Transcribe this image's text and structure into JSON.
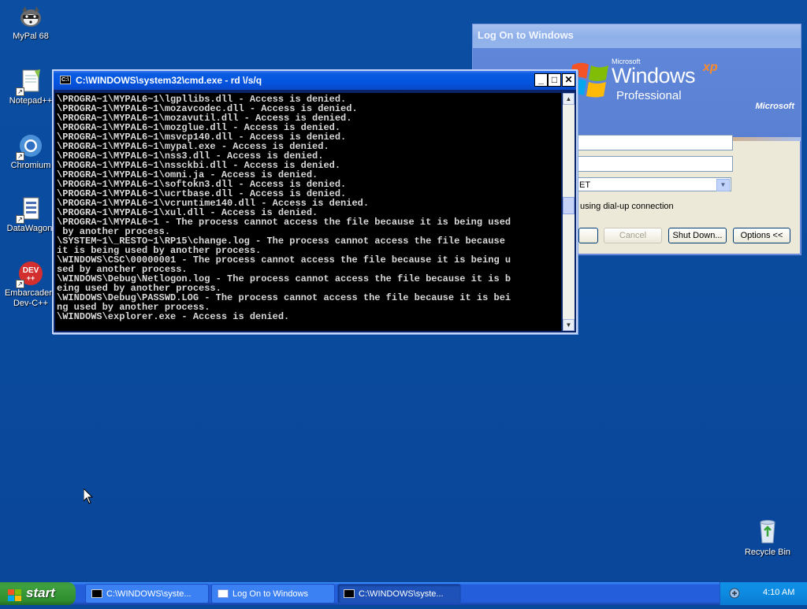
{
  "desktop_icons": [
    {
      "label": "MyPal 68",
      "icon": "raccoon-icon"
    },
    {
      "label": "Notepad++",
      "icon": "notepadpp-icon"
    },
    {
      "label": "Chromium",
      "icon": "chromium-icon"
    },
    {
      "label": "DataWagon.",
      "icon": "datawagon-icon"
    },
    {
      "label": "Embarcadero\nDev-C++",
      "icon": "devcpp-icon",
      "badge": "DEV\n++"
    }
  ],
  "recycle_bin": {
    "label": "Recycle Bin",
    "icon": "recycle-bin-icon"
  },
  "logon": {
    "title": "Log On to Windows",
    "brand_small": "Microsoft",
    "brand_windows": "Windows",
    "brand_xp": "xp",
    "brand_edition": "Professional",
    "brand_ms_logo": "Microsoft",
    "domain_value": "ET",
    "dialup_text": "using dial-up connection",
    "buttons": {
      "ok": "",
      "cancel": "Cancel",
      "shutdown": "Shut Down...",
      "options": "Options <<"
    }
  },
  "cmd": {
    "title": "C:\\WINDOWS\\system32\\cmd.exe - rd \\/s/q",
    "controls": {
      "minimize": "_",
      "maximize": "□",
      "close": "✕"
    },
    "lines": [
      "\\PROGRA~1\\MYPAL6~1\\lgpllibs.dll - Access is denied.",
      "\\PROGRA~1\\MYPAL6~1\\mozavcodec.dll - Access is denied.",
      "\\PROGRA~1\\MYPAL6~1\\mozavutil.dll - Access is denied.",
      "\\PROGRA~1\\MYPAL6~1\\mozglue.dll - Access is denied.",
      "\\PROGRA~1\\MYPAL6~1\\msvcp140.dll - Access is denied.",
      "\\PROGRA~1\\MYPAL6~1\\mypal.exe - Access is denied.",
      "\\PROGRA~1\\MYPAL6~1\\nss3.dll - Access is denied.",
      "\\PROGRA~1\\MYPAL6~1\\nssckbi.dll - Access is denied.",
      "\\PROGRA~1\\MYPAL6~1\\omni.ja - Access is denied.",
      "\\PROGRA~1\\MYPAL6~1\\softokn3.dll - Access is denied.",
      "\\PROGRA~1\\MYPAL6~1\\ucrtbase.dll - Access is denied.",
      "\\PROGRA~1\\MYPAL6~1\\vcruntime140.dll - Access is denied.",
      "\\PROGRA~1\\MYPAL6~1\\xul.dll - Access is denied.",
      "\\PROGRA~1\\MYPAL6~1 - The process cannot access the file because it is being used",
      " by another process.",
      "\\SYSTEM~1\\_RESTO~1\\RP15\\change.log - The process cannot access the file because",
      "it is being used by another process.",
      "\\WINDOWS\\CSC\\00000001 - The process cannot access the file because it is being u",
      "sed by another process.",
      "\\WINDOWS\\Debug\\Netlogon.log - The process cannot access the file because it is b",
      "eing used by another process.",
      "\\WINDOWS\\Debug\\PASSWD.LOG - The process cannot access the file because it is bei",
      "ng used by another process.",
      "\\WINDOWS\\explorer.exe - Access is denied."
    ]
  },
  "taskbar": {
    "start_label": "start",
    "tasks": [
      {
        "label": "C:\\WINDOWS\\syste...",
        "icon": "cmd-icon",
        "active": false
      },
      {
        "label": "Log On to Windows",
        "icon": "window-icon",
        "active": false
      },
      {
        "label": "C:\\WINDOWS\\syste...",
        "icon": "cmd-icon",
        "active": true
      }
    ],
    "clock": "4:10 AM"
  },
  "colors": {
    "desktop": "#0a4a9d",
    "taskbar": "#245edb",
    "start": "#3e9f3e",
    "cmd_title": "#0454e0"
  }
}
